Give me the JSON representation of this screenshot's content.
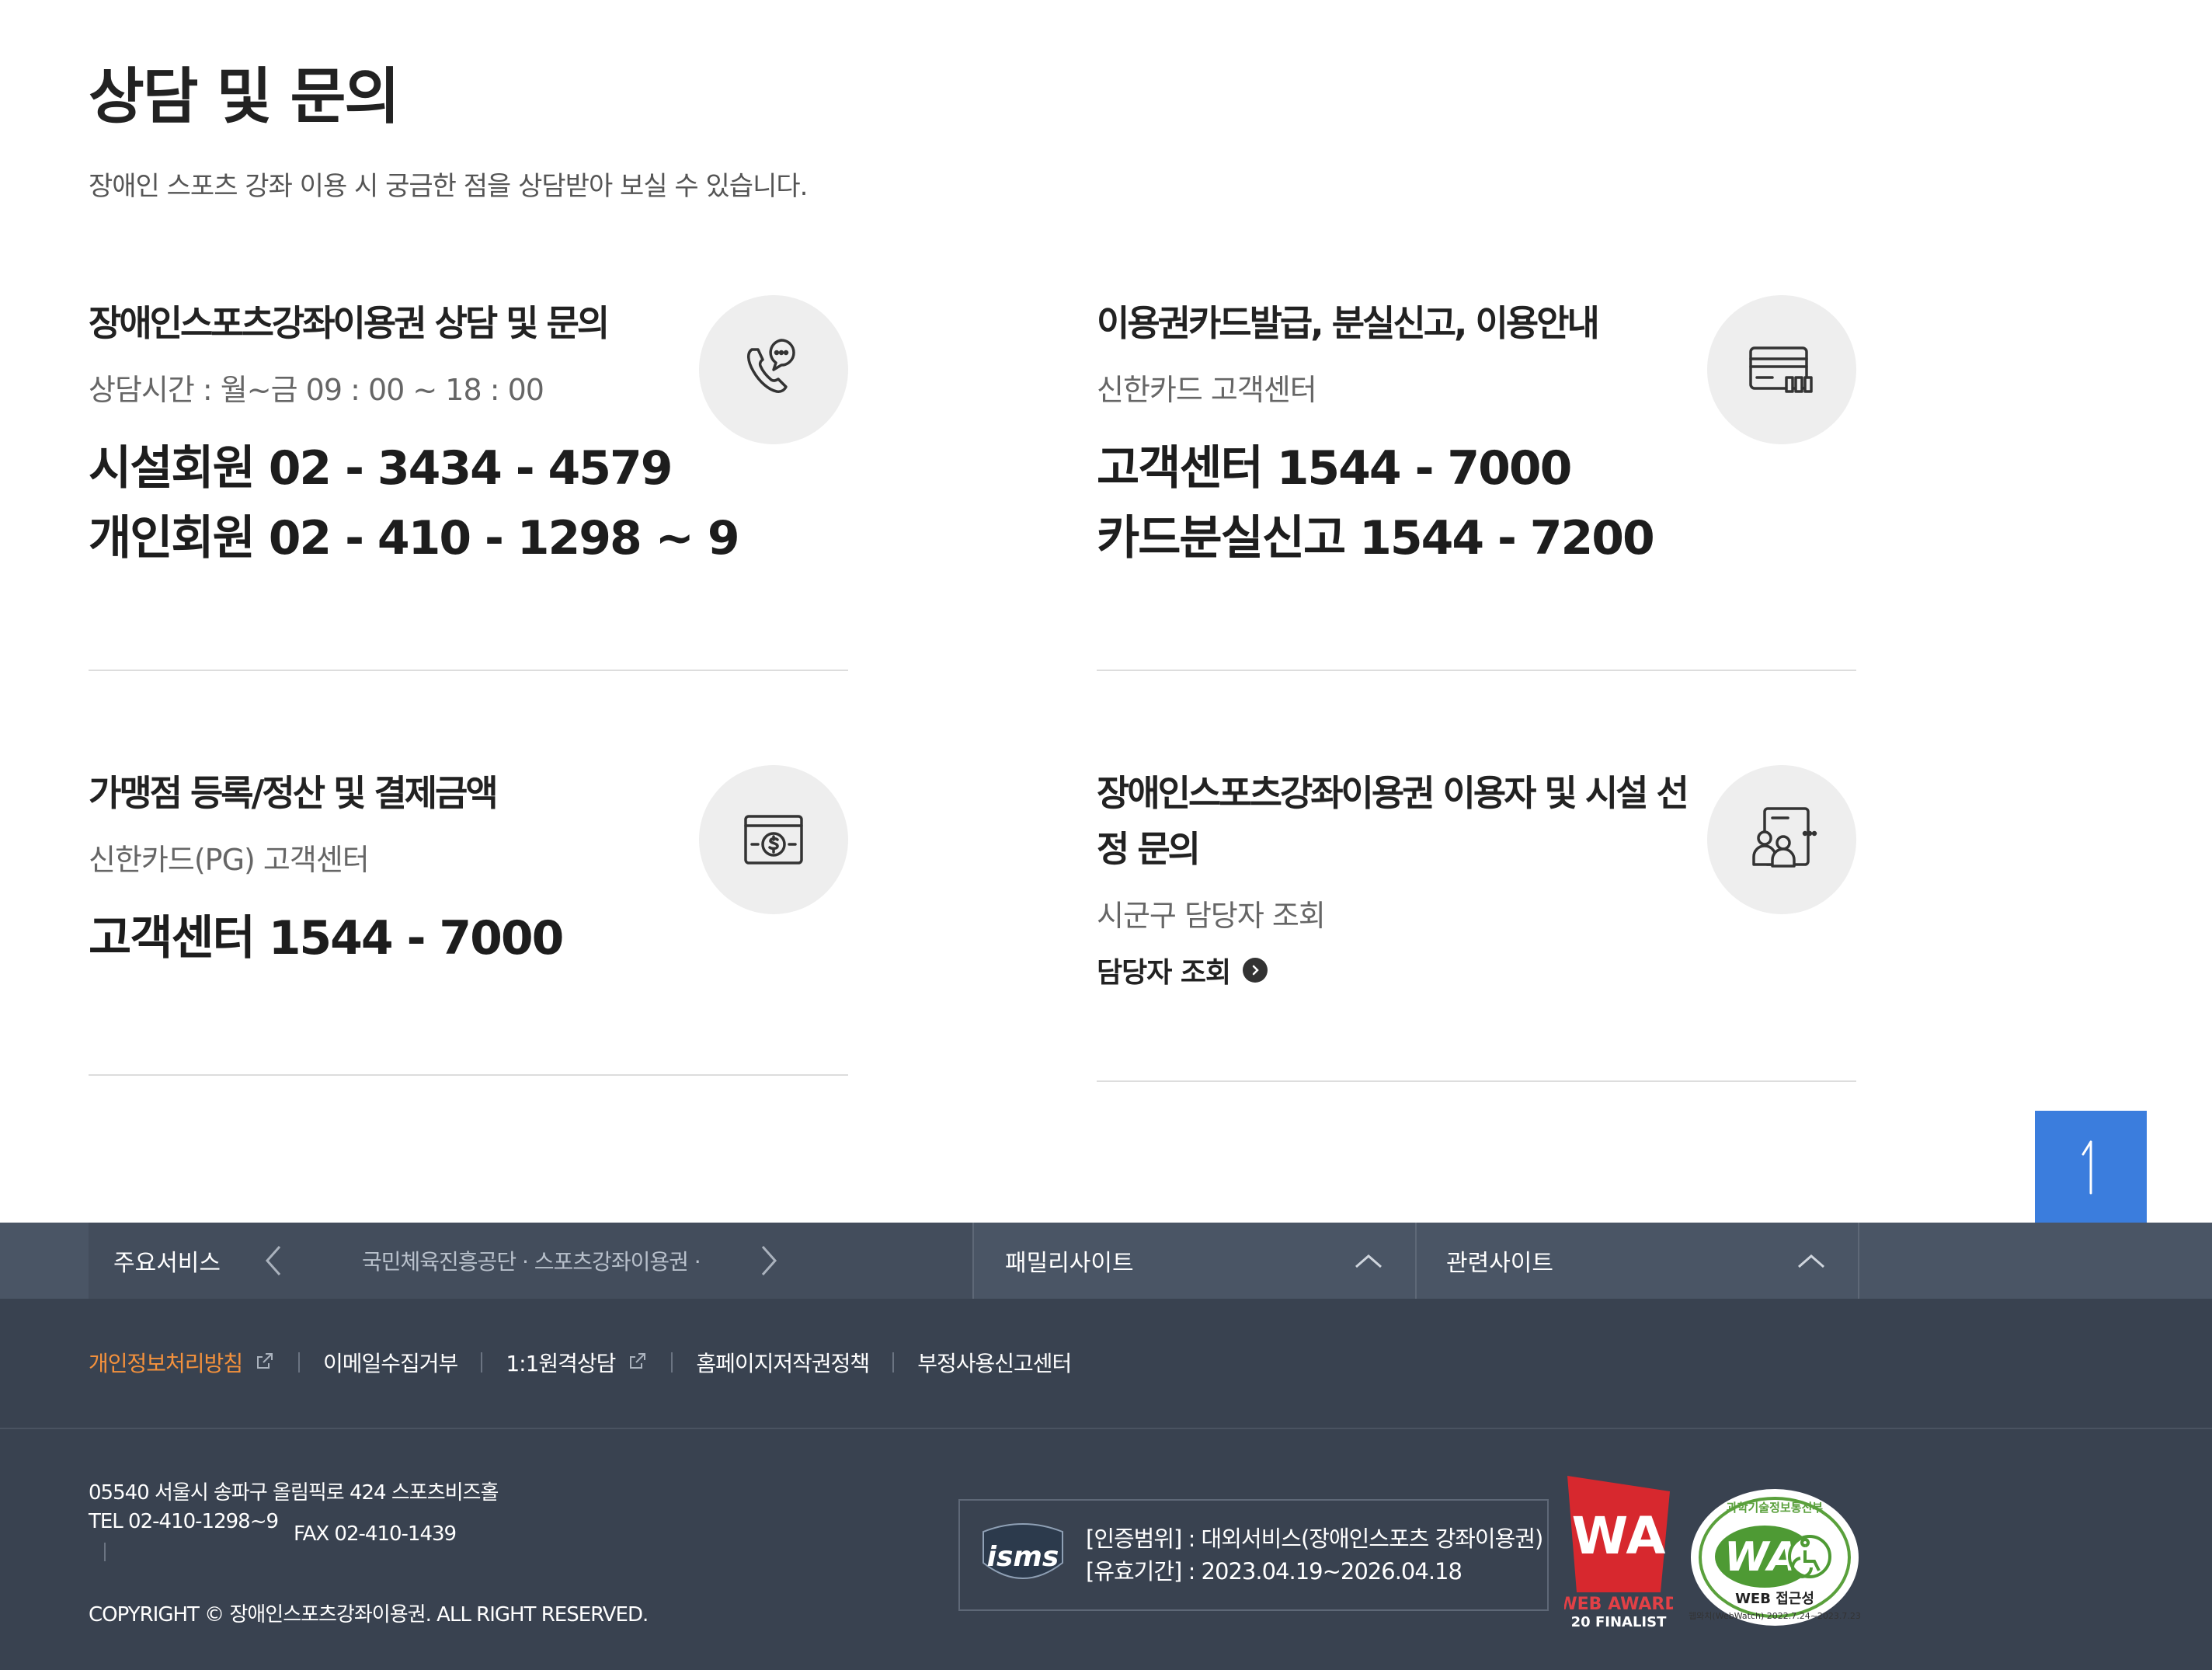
{
  "page": {
    "title": "상담 및 문의",
    "description": "장애인 스포츠 강좌 이용 시 궁금한 점을 상담받아 보실 수 있습니다."
  },
  "cards": [
    {
      "title": "장애인스포츠강좌이용권 상담 및 문의",
      "sub": "상담시간 : 월~금 09 : 00 ~ 18 : 00",
      "lines": [
        "시설회원 02 - 3434 - 4579",
        "개인회원 02 - 410 - 1298 ~ 9"
      ],
      "icon": "phone-chat-icon"
    },
    {
      "title": "이용권카드발급, 분실신고, 이용안내",
      "sub": "신한카드 고객센터",
      "lines": [
        "고객센터 1544 - 7000",
        "카드분실신고 1544 - 7200"
      ],
      "icon": "card-icon"
    },
    {
      "title": "가맹점 등록/정산 및 결제금액",
      "sub": "신한카드(PG) 고객센터",
      "lines": [
        "고객센터 1544 - 7000"
      ],
      "icon": "payment-icon"
    },
    {
      "title": "장애인스포츠강좌이용권 이용자 및 시설 선정 문의",
      "sub": "시군구 담당자 조회",
      "link": "담당자 조회",
      "icon": "contact-person-icon"
    }
  ],
  "site_bar": {
    "main_label": "주요서비스",
    "main_items": "국민체육진흥공단 · 스포츠강좌이용권 ·",
    "family_label": "패밀리사이트",
    "related_label": "관련사이트"
  },
  "footer": {
    "links": [
      "개인정보처리방침",
      "이메일수집거부",
      "1:1원격상담",
      "홈페이지저작권정책",
      "부정사용신고센터"
    ],
    "address": "05540 서울시 송파구 올림픽로 424 스포츠비즈홀",
    "tel": "TEL 02-410-1298~9",
    "fax": "FAX 02-410-1439",
    "copyright": "COPYRIGHT © 장애인스포츠강좌이용권. ALL RIGHT RESERVED.",
    "cert_scope": "[인증범위] : 대외서비스(장애인스포츠 강좌이용권)",
    "cert_period": "[유효기간] : 2023.04.19~2026.04.18",
    "isms_text": "isms",
    "web_award_text": "WEB AWARD",
    "web_award_sub": "20 FINALIST",
    "wa_access_top": "과학기술정보통신부",
    "wa_access_label": "WEB 접근성",
    "wa_access_bottom": "웹와치(WebWatch) 2022.7.24~2023.7.23"
  },
  "colors": {
    "accent": "#3b7ddd",
    "footer_bg": "#394250",
    "active_link": "#f4913c",
    "icon_bg": "#eeeeee"
  }
}
